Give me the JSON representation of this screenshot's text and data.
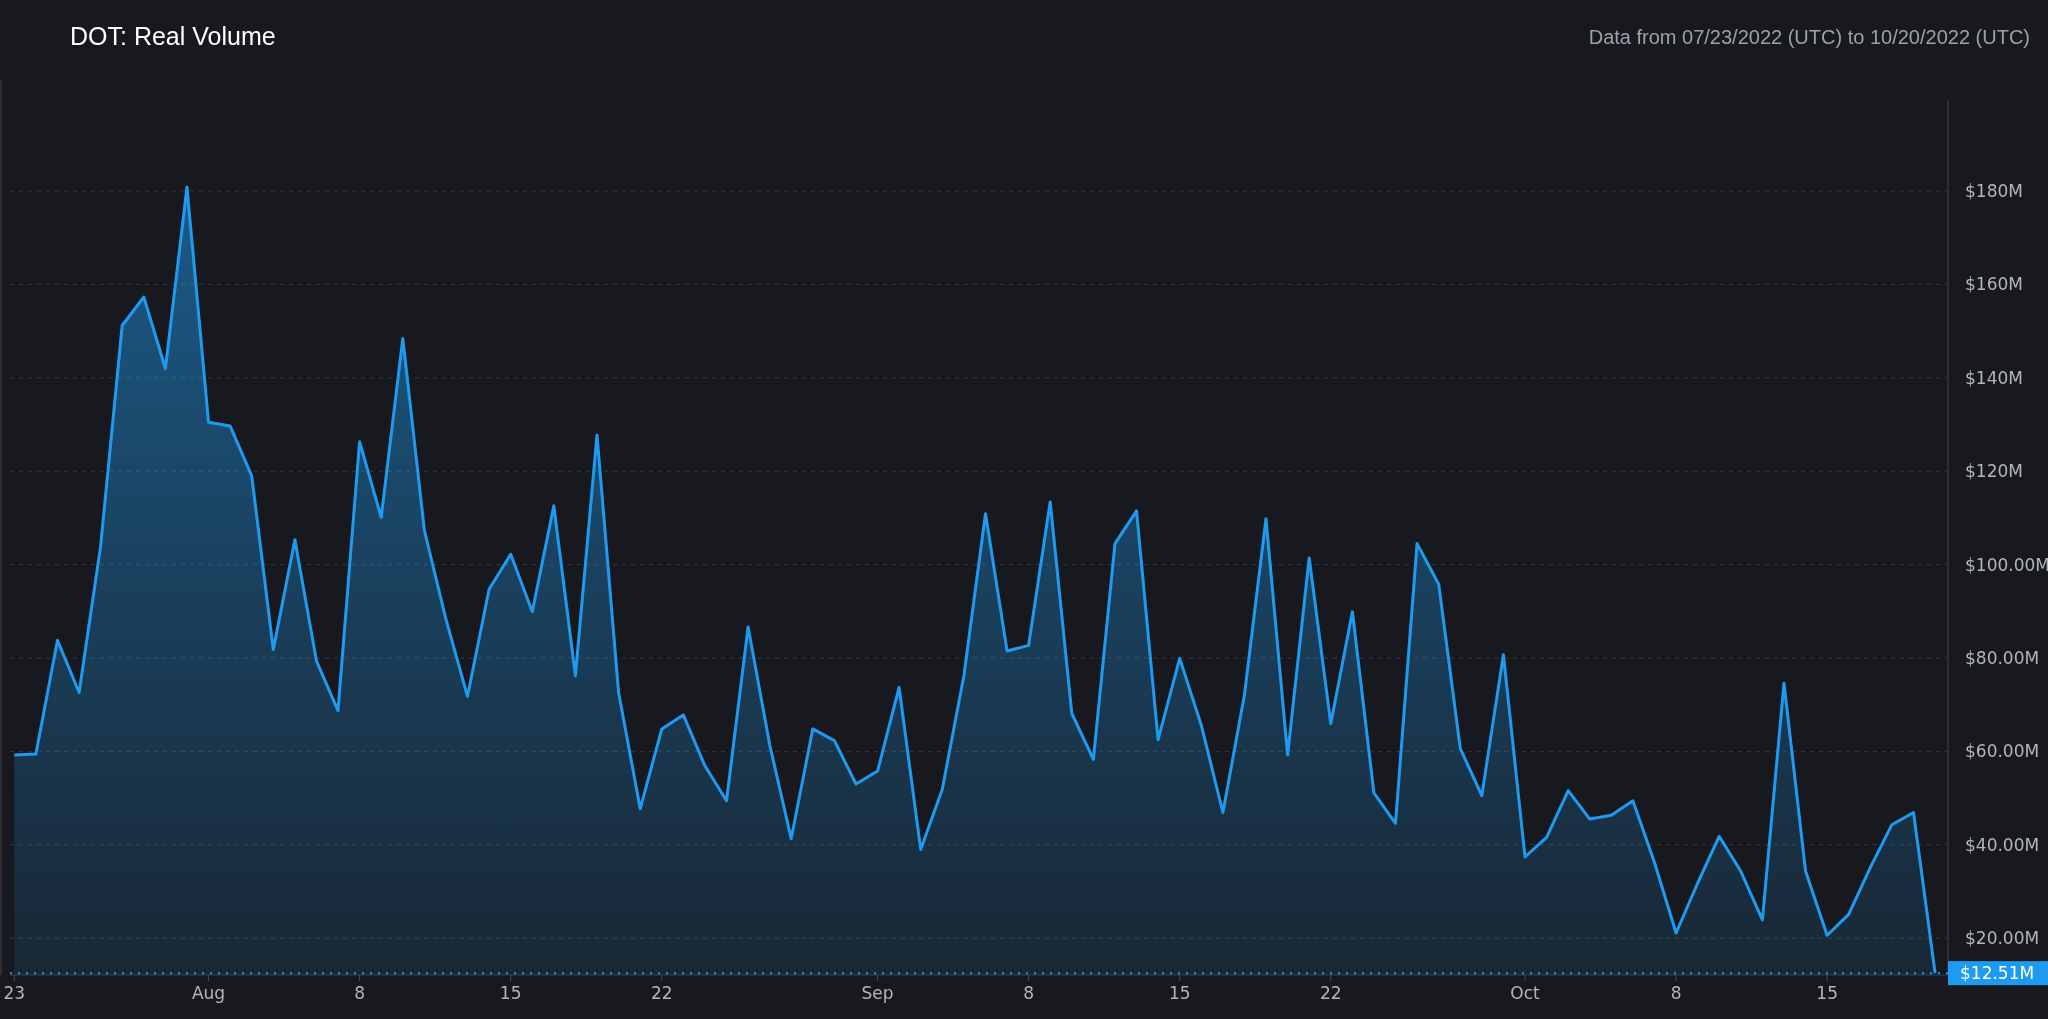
{
  "date_range": "Data from 07/23/2022 (UTC) to 10/20/2022 (UTC)",
  "chart_data": {
    "type": "area",
    "title": "DOT: Real Volume",
    "categories": [
      "23",
      null,
      null,
      null,
      null,
      null,
      null,
      null,
      null,
      "Aug",
      null,
      null,
      null,
      null,
      null,
      null,
      "8",
      null,
      null,
      null,
      null,
      null,
      null,
      "15",
      null,
      null,
      null,
      null,
      null,
      null,
      "22",
      null,
      null,
      null,
      null,
      null,
      null,
      null,
      null,
      null,
      "Sep",
      null,
      null,
      null,
      null,
      null,
      null,
      "8",
      null,
      null,
      null,
      null,
      null,
      null,
      "15",
      null,
      null,
      null,
      null,
      null,
      null,
      "22",
      null,
      null,
      null,
      null,
      null,
      null,
      null,
      null,
      "Oct",
      null,
      null,
      null,
      null,
      null,
      null,
      "8",
      null,
      null,
      null,
      null,
      null,
      null,
      "15",
      null,
      null,
      null,
      null,
      null
    ],
    "series": [
      {
        "color": "#1e9bf0",
        "values": [
          59.2,
          59.4,
          83.8,
          72.6,
          103.9,
          151.2,
          157.3,
          142.0,
          180.8,
          130.5,
          129.7,
          119.0,
          81.8,
          105.3,
          79.3,
          68.7,
          126.3,
          110.1,
          148.4,
          107.3,
          88.3,
          71.8,
          94.7,
          102.2,
          89.9,
          112.6,
          76.2,
          127.7,
          72.6,
          47.7,
          64.8,
          67.8,
          56.9,
          49.4,
          86.6,
          61.4,
          41.3,
          64.8,
          62.3,
          53.0,
          55.8,
          73.7,
          39.0,
          51.9,
          76.2,
          110.9,
          81.5,
          82.7,
          113.4,
          68.1,
          58.3,
          104.5,
          111.5,
          62.5,
          79.9,
          65.6,
          46.9,
          72.0,
          109.8,
          59.2,
          101.4,
          65.9,
          89.9,
          51.1,
          44.6,
          104.5,
          95.8,
          60.6,
          50.5,
          80.7,
          37.4,
          41.6,
          51.6,
          45.5,
          46.3,
          49.4,
          36.2,
          21.1,
          31.8,
          41.8,
          34.3,
          23.9,
          74.6,
          34.3,
          20.6,
          25.1,
          35.1,
          44.3,
          46.9,
          12.5
        ]
      }
    ],
    "ylim": [
      12.1,
      199.5
    ],
    "grid": true,
    "yticks": [
      {
        "value": 20,
        "label": "$20.00M"
      },
      {
        "value": 40,
        "label": "$40.00M"
      },
      {
        "value": 60,
        "label": "$60.00M"
      },
      {
        "value": 80,
        "label": "$80.00M"
      },
      {
        "value": 100,
        "label": "$100.00M"
      },
      {
        "value": 120,
        "label": "$120M"
      },
      {
        "value": 140,
        "label": "$140M"
      },
      {
        "value": 160,
        "label": "$160M"
      },
      {
        "value": 180,
        "label": "$180M"
      }
    ],
    "annotations": [
      "$12.51M"
    ]
  }
}
